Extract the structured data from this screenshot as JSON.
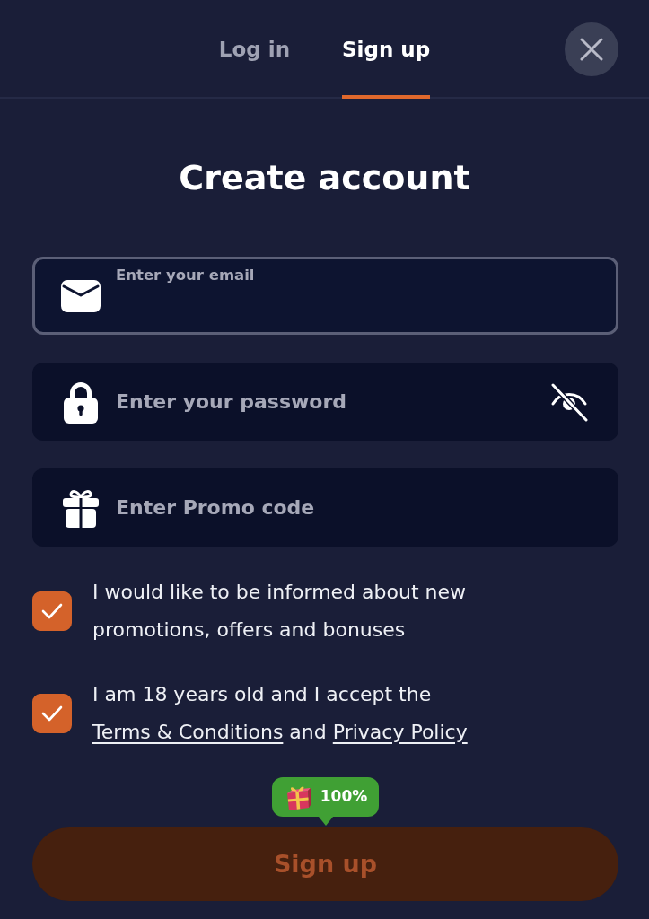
{
  "header": {
    "tabs": [
      {
        "label": "Log in",
        "selected": false
      },
      {
        "label": "Sign up",
        "selected": true
      }
    ]
  },
  "title": "Create account",
  "fields": [
    {
      "kind": "email",
      "placeholder": "Enter your email",
      "focused": true
    },
    {
      "kind": "password",
      "placeholder": "Enter your password",
      "focused": false,
      "password_hidden": true
    },
    {
      "kind": "promo",
      "placeholder": "Enter Promo code",
      "focused": false
    }
  ],
  "consents": [
    {
      "checked": true,
      "parts": [
        {
          "kind": "text",
          "text": "I would like to be informed about new promotions, offers and bonuses"
        }
      ]
    },
    {
      "checked": true,
      "parts": [
        {
          "kind": "text",
          "text": "I am 18 years old and I accept the "
        },
        {
          "kind": "link",
          "text": "Terms & Conditions"
        },
        {
          "kind": "text",
          "text": " and "
        },
        {
          "kind": "link",
          "text": "Privacy Policy"
        }
      ]
    }
  ],
  "bonus_badge": {
    "text": "100%"
  },
  "submit": {
    "label": "Sign up",
    "disabled": true
  }
}
